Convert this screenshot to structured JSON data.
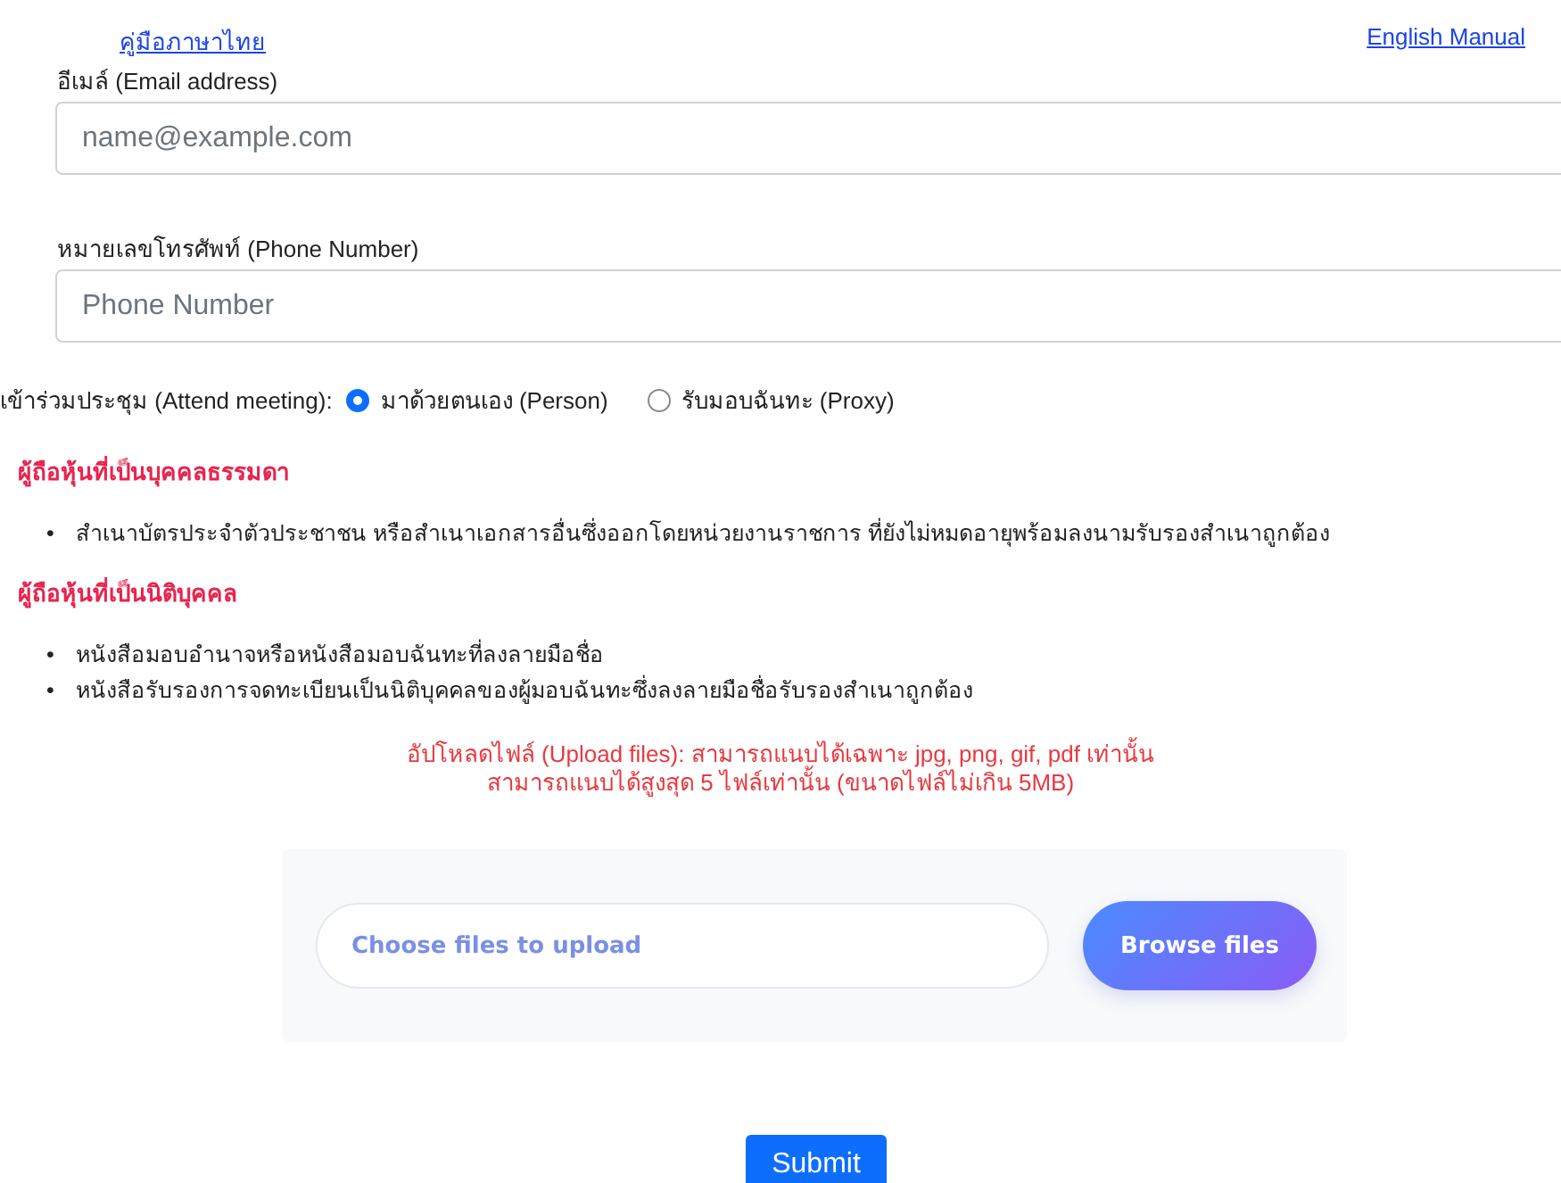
{
  "manual_links": [
    {
      "label": "คู่มือภาษาไทย"
    },
    {
      "label": "English Manual"
    }
  ],
  "fields": [
    {
      "label": "อีเมล์ (Email address)",
      "placeholder": "name@example.com"
    },
    {
      "label": "หมายเลขโทรศัพท์ (Phone Number)",
      "placeholder": "Phone Number"
    }
  ],
  "attend_meeting": {
    "label": "เข้าร่วมประชุม (Attend meeting):",
    "options": [
      {
        "label": "มาด้วยตนเอง (Person)",
        "selected": true
      },
      {
        "label": "รับมอบฉันทะ (Proxy)",
        "selected": false
      }
    ]
  },
  "sections": [
    {
      "heading": "ผู้ถือหุ้นที่เป็นบุคคลธรรมดา",
      "items": [
        {
          "bullet": "•",
          "text": "สำเนาบัตรประจำตัวประชาชน หรือสำเนาเอกสารอื่นซึ่งออกโดยหน่วยงานราชการ ที่ยังไม่หมดอายุพร้อมลงนามรับรองสำเนาถูกต้อง"
        }
      ]
    },
    {
      "heading": "ผู้ถือหุ้นที่เป็นนิติบุคคล",
      "items": [
        {
          "bullet": "•",
          "text": "หนังสือมอบอำนาจหรือหนังสือมอบฉันทะที่ลงลายมือชื่อ"
        },
        {
          "bullet": "•",
          "text": "หนังสือรับรองการจดทะเบียนเป็นนิติบุคคลของผู้มอบฉันทะซึ่งลงลายมือชื่อรับรองสำเนาถูกต้อง"
        }
      ]
    }
  ],
  "upload_note": [
    "อัปโหลดไฟล์ (Upload files): สามารถแนบได้เฉพาะ jpg, png, gif, pdf เท่านั้น",
    "สามารถแนบได้สูงสุด 5 ไฟล์เท่านั้น (ขนาดไฟล์ไม่เกิน 5MB)"
  ],
  "upload": {
    "placeholder": "Choose files to upload",
    "button": "Browse files"
  },
  "submit": "Submit"
}
